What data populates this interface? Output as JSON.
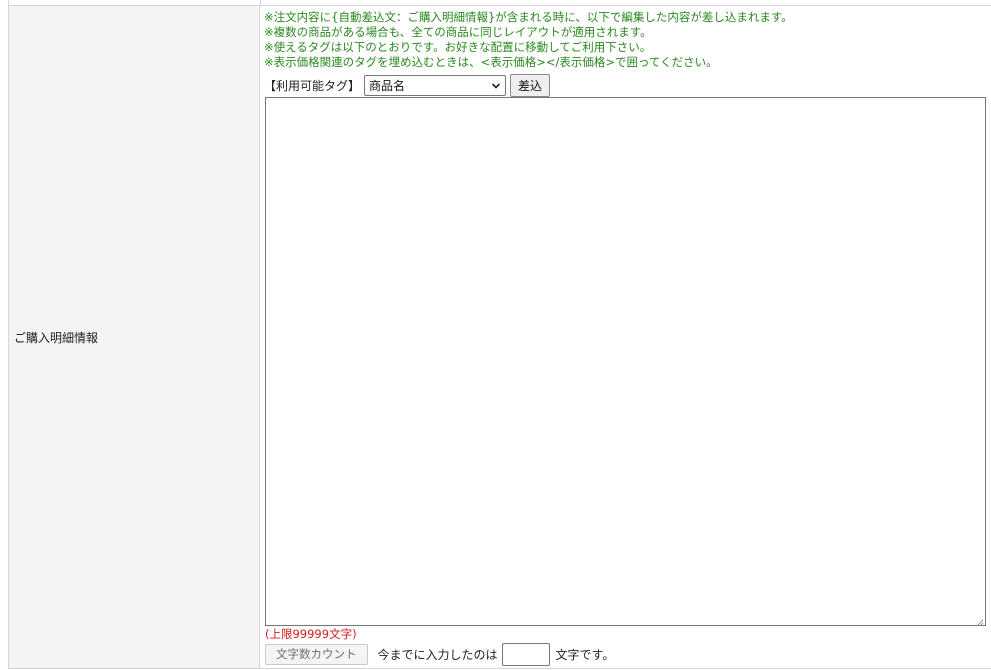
{
  "field": {
    "label": "ご購入明細情報"
  },
  "notes": [
    "※注文内容に{自動差込文：ご購入明細情報}が含まれる時に、以下で編集した内容が差し込まれます。",
    "※複数の商品がある場合も、全ての商品に同じレイアウトが適用されます。",
    "※使えるタグは以下のとおりです。お好きな配置に移動してご利用下さい。",
    "※表示価格関連のタグを埋め込むときは、<表示価格></表示価格>で囲ってください。"
  ],
  "tag_selector": {
    "label": "【利用可能タグ】",
    "selected": "商品名",
    "insert_button": "差込"
  },
  "editor": {
    "value": ""
  },
  "limit": {
    "text": "(上限99999文字)"
  },
  "char_count": {
    "button_label": "文字数カウント",
    "prefix": "今までに入力したのは",
    "value": "",
    "suffix": "文字です。"
  },
  "colors": {
    "note_text": "#2a8a1f",
    "limit_text": "#d11a1a",
    "label_bg": "#f3f4f3"
  }
}
